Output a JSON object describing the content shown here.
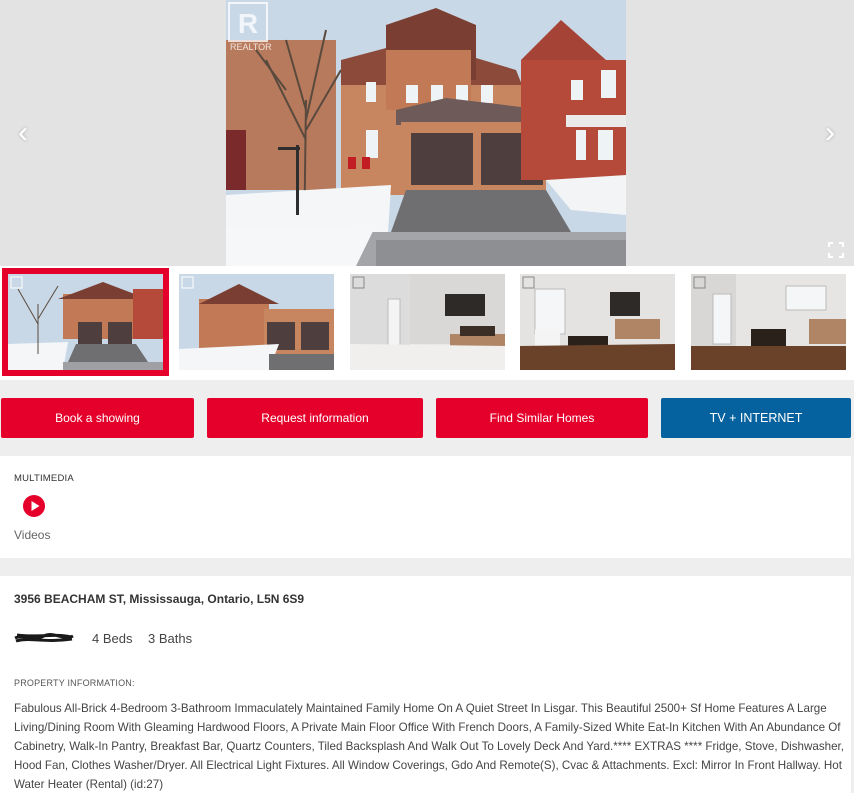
{
  "gallery": {
    "watermark": "REALTOR",
    "prev_label": "‹",
    "next_label": "›",
    "thumbnails": [
      {
        "name": "exterior-front",
        "active": true
      },
      {
        "name": "exterior-side",
        "active": false
      },
      {
        "name": "front-hallway",
        "active": false
      },
      {
        "name": "living-room",
        "active": false
      },
      {
        "name": "living-room-2",
        "active": false
      }
    ]
  },
  "actions": {
    "book_label": "Book a showing",
    "request_label": "Request information",
    "similar_label": "Find Similar Homes",
    "tv_label": "TV + INTERNET"
  },
  "multimedia": {
    "heading": "MULTIMEDIA",
    "videos_label": "Videos",
    "icon": "play-circle-icon"
  },
  "listing": {
    "address": "3956 BEACHAM ST, Mississauga, Ontario, L5N 6S9",
    "beds": "4 Beds",
    "baths": "3 Baths",
    "info_heading": "PROPERTY INFORMATION:",
    "description": "Fabulous All-Brick 4-Bedroom 3-Bathroom Immaculately Maintained Family Home On A Quiet Street In Lisgar. This Beautiful 2500+ Sf Home Features A Large Living/Dining Room With Gleaming Hardwood Floors, A Private Main Floor Office With French Doors, A Family-Sized White Eat-In Kitchen With An Abundance Of Cabinetry, Walk-In Pantry, Breakfast Bar, Quartz Counters, Tiled Backsplash And Walk Out To Lovely Deck And Yard.**** EXTRAS **** Fridge, Stove, Dishwasher, Hood Fan, Clothes Washer/Dryer. All Electrical Light Fixtures. All Window Coverings, Gdo And Remote(S), Cvac & Attachments. Excl: Mirror In Front Hallway. Hot Water Heater (Rental) (id:27)"
  },
  "colors": {
    "brand_red": "#e4002b",
    "brand_blue": "#06629e"
  }
}
